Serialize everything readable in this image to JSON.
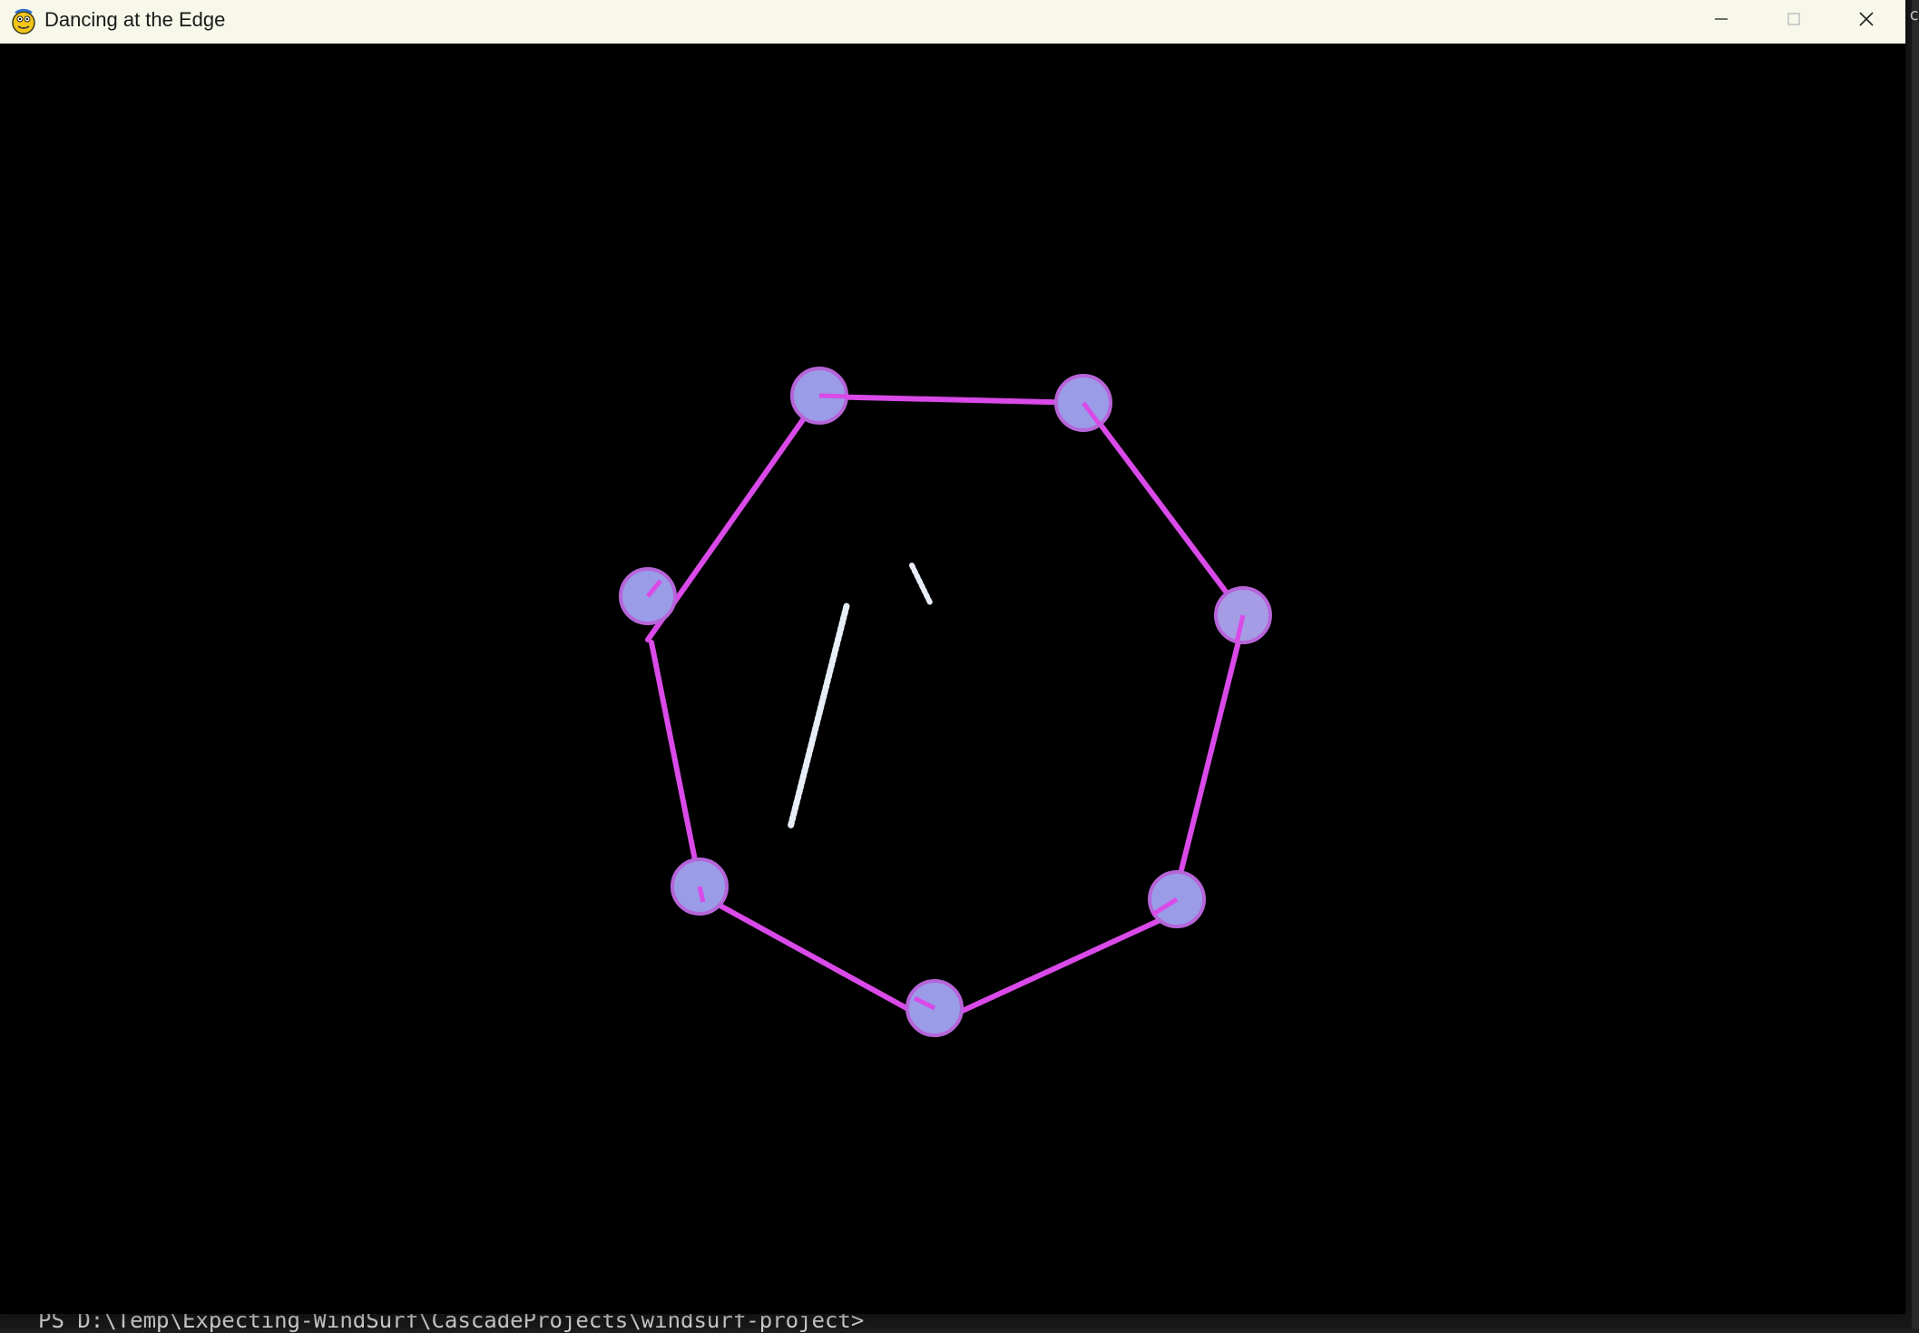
{
  "window": {
    "title": "Dancing at the Edge",
    "app_icon": "pygame-snake-icon",
    "buttons": {
      "minimize": "minimize-icon",
      "maximize": "maximize-icon",
      "close": "close-icon"
    }
  },
  "scene": {
    "background": "#000000",
    "polygon_stroke": "#d94ae8",
    "node_fill": "#9a9ce8",
    "node_stroke": "#b665d9",
    "particle_color": "#e8eef8",
    "node_count": 7
  },
  "terminal": {
    "prompt": "PS D:\\Temp\\Expecting-WindSurf\\CascadeProjects\\windsurf-project>",
    "edge_text": "c:"
  }
}
